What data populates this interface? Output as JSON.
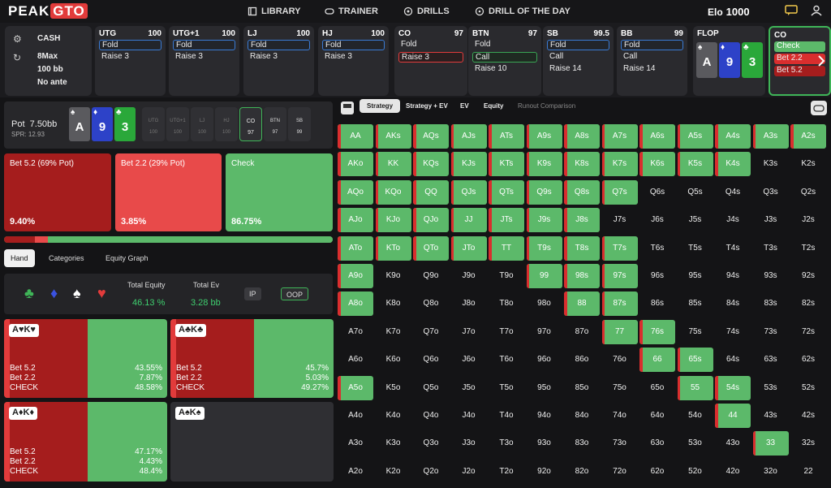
{
  "nav": {
    "logo_a": "PEAK",
    "logo_b": "GTO",
    "items": [
      "LIBRARY",
      "TRAINER",
      "DRILLS",
      "DRILL OF THE DAY"
    ],
    "elo_label": "Elo",
    "elo_value": "1000"
  },
  "game": {
    "type": "CASH",
    "table": "8Max",
    "stack": "100 bb",
    "ante": "No ante"
  },
  "seats": [
    {
      "pos": "UTG",
      "stack": "100",
      "actions": [
        "Fold",
        "Raise 3"
      ],
      "selected": 0
    },
    {
      "pos": "UTG+1",
      "stack": "100",
      "actions": [
        "Fold",
        "Raise 3"
      ],
      "selected": 0
    },
    {
      "pos": "LJ",
      "stack": "100",
      "actions": [
        "Fold",
        "Raise 3"
      ],
      "selected": 0
    },
    {
      "pos": "HJ",
      "stack": "100",
      "actions": [
        "Fold",
        "Raise 3"
      ],
      "selected": 0
    },
    {
      "pos": "CO",
      "stack": "97",
      "actions": [
        "Fold",
        "Raise 3"
      ],
      "selected": 1
    },
    {
      "pos": "BTN",
      "stack": "97",
      "actions": [
        "Fold",
        "Call",
        "Raise 10"
      ],
      "selected": 1
    },
    {
      "pos": "SB",
      "stack": "99.5",
      "actions": [
        "Fold",
        "Call",
        "Raise 14"
      ],
      "selected": 0
    },
    {
      "pos": "BB",
      "stack": "99",
      "actions": [
        "Fold",
        "Call",
        "Raise 14"
      ],
      "selected": 0
    }
  ],
  "flop": {
    "label": "FLOP",
    "cards": [
      {
        "rank": "A",
        "suit": "♠"
      },
      {
        "rank": "9",
        "suit": "♦"
      },
      {
        "rank": "3",
        "suit": "♣"
      }
    ]
  },
  "co_seat": {
    "pos": "CO",
    "actions": [
      "Check",
      "Bet 2.2",
      "Bet 5.2"
    ]
  },
  "pot": {
    "label": "Pot",
    "value": "7.50bb",
    "spr": "SPR: 12.93"
  },
  "mini_seats": [
    {
      "pos": "UTG",
      "stack": "100"
    },
    {
      "pos": "UTG+1",
      "stack": "100"
    },
    {
      "pos": "LJ",
      "stack": "100"
    },
    {
      "pos": "HJ",
      "stack": "100"
    },
    {
      "pos": "CO",
      "stack": "97"
    },
    {
      "pos": "BTN",
      "stack": "97"
    },
    {
      "pos": "SB",
      "stack": "99"
    }
  ],
  "strategy": [
    {
      "label": "Bet 5.2 (69% Pot)",
      "pct": "9.40%",
      "color": "#a51d1d",
      "freq": 0.094
    },
    {
      "label": "Bet 2.2 (29% Pot)",
      "pct": "3.85%",
      "color": "#e84a4a",
      "freq": 0.0385
    },
    {
      "label": "Check",
      "pct": "86.75%",
      "color": "#5cb96a",
      "freq": 0.8675
    }
  ],
  "hand_tabs": [
    "Hand",
    "Categories",
    "Equity Graph"
  ],
  "equity": {
    "eq_label": "Total Equity",
    "eq_value": "46.13 %",
    "ev_label": "Total Ev",
    "ev_value": "3.28 bb",
    "ip": "IP",
    "oop": "OOP"
  },
  "combos": [
    {
      "label": "A♥K♥",
      "rows": [
        [
          "Bet 5.2",
          "43.55%"
        ],
        [
          "Bet 2.2",
          "7.87%"
        ],
        [
          "CHECK",
          "48.58%"
        ]
      ]
    },
    {
      "label": "A♣K♣",
      "rows": [
        [
          "Bet 5.2",
          "45.7%"
        ],
        [
          "Bet 2.2",
          "5.03%"
        ],
        [
          "CHECK",
          "49.27%"
        ]
      ]
    },
    {
      "label": "A♦K♦",
      "rows": [
        [
          "Bet 5.2",
          "47.17%"
        ],
        [
          "Bet 2.2",
          "4.43%"
        ],
        [
          "CHECK",
          "48.4%"
        ]
      ]
    },
    {
      "label": "A♠K♠",
      "rows": []
    }
  ],
  "right_tabs": [
    "Strategy",
    "Strategy + EV",
    "EV",
    "Equity",
    "Runout Comparison"
  ],
  "grid": {
    "ranks": [
      "A",
      "K",
      "Q",
      "J",
      "T",
      "9",
      "8",
      "7",
      "6",
      "5",
      "4",
      "3",
      "2"
    ],
    "highlight": [
      "AA",
      "AKs",
      "AQs",
      "AJs",
      "ATs",
      "A9s",
      "A8s",
      "A7s",
      "A6s",
      "A5s",
      "A4s",
      "A3s",
      "A2s",
      "AKo",
      "KK",
      "KQs",
      "KJs",
      "KTs",
      "K9s",
      "K8s",
      "K7s",
      "K6s",
      "K5s",
      "K4s",
      "AQo",
      "KQo",
      "QQ",
      "QJs",
      "QTs",
      "Q9s",
      "Q8s",
      "Q7s",
      "AJo",
      "KJo",
      "QJo",
      "JJ",
      "JTs",
      "J9s",
      "J8s",
      "ATo",
      "KTo",
      "QTo",
      "JTo",
      "TT",
      "T9s",
      "T8s",
      "T7s",
      "A9o",
      "99",
      "98s",
      "97s",
      "A8o",
      "88",
      "87s",
      "77",
      "76s",
      "66",
      "65s",
      "A5o",
      "55",
      "54s",
      "44",
      "33"
    ]
  }
}
